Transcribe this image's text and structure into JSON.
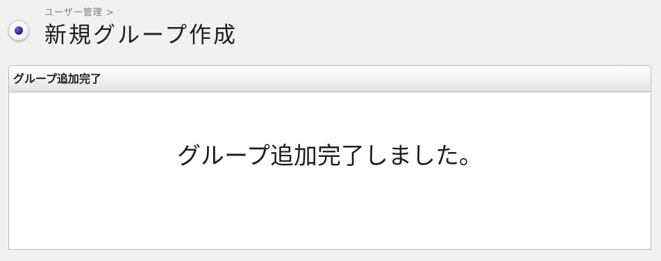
{
  "header": {
    "icon": "radio-bullet-icon",
    "breadcrumb": "ユーザー管理 >",
    "title": "新規グループ作成"
  },
  "panel": {
    "title": "グループ追加完了",
    "message": "グループ追加完了しました。"
  }
}
